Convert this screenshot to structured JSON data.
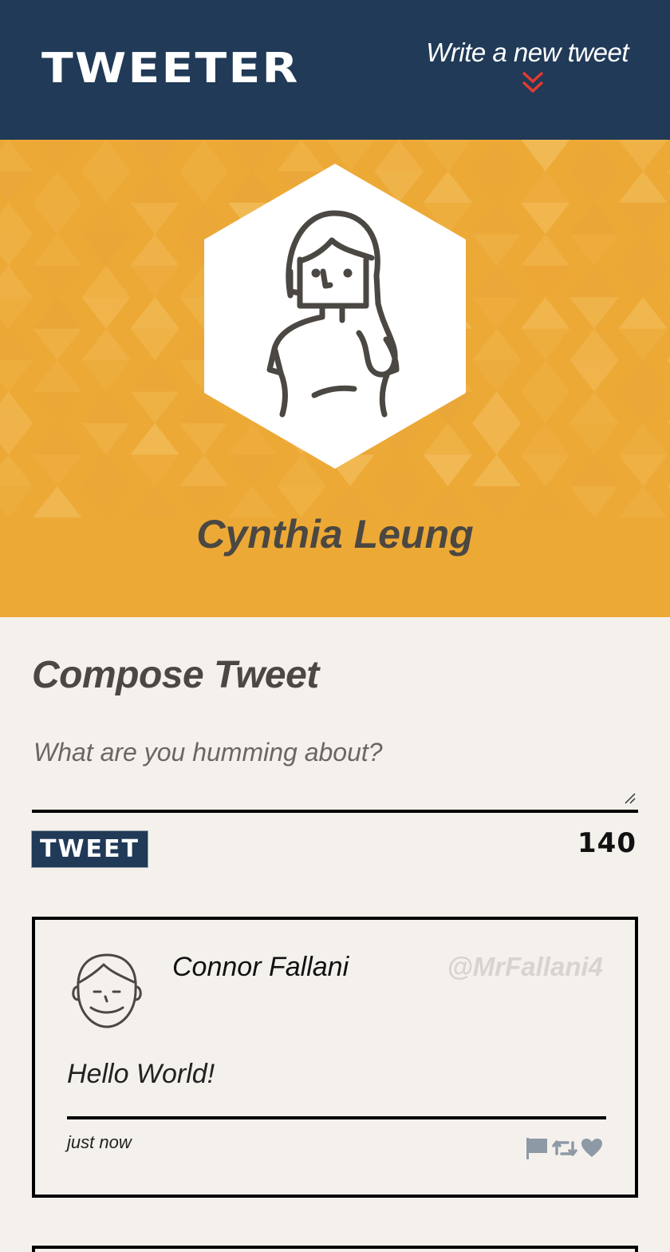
{
  "nav": {
    "logo": "TWEETER",
    "compose_label": "Write a new tweet",
    "compose_icon": "double-chevron-down-icon",
    "chevron_color": "#e23a2e"
  },
  "profile": {
    "name": "Cynthia Leung",
    "avatar_icon": "woman-avatar-icon",
    "background_color": "#eda936"
  },
  "compose": {
    "title": "Compose Tweet",
    "placeholder": "What are you humming about?",
    "button_label": "TWEET",
    "char_count": "140"
  },
  "tweets": [
    {
      "name": "Connor Fallani",
      "handle": "@MrFallani4",
      "body": "Hello World!",
      "time": "just now",
      "avatar_icon": "man-avatar-icon",
      "actions": [
        "flag-icon",
        "retweet-icon",
        "heart-icon"
      ]
    }
  ]
}
